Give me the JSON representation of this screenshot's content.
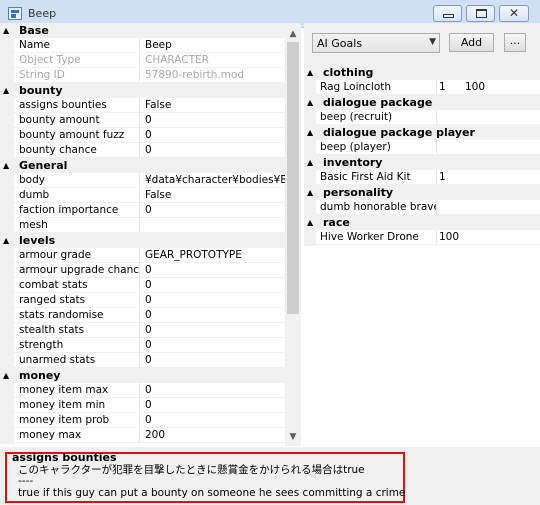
{
  "window": {
    "title": "Beep"
  },
  "left_grid": {
    "categories": [
      {
        "name": "Base",
        "rows": [
          {
            "name": "Name",
            "value": "Beep",
            "disabled": false
          },
          {
            "name": "Object Type",
            "value": "CHARACTER",
            "disabled": true
          },
          {
            "name": "String ID",
            "value": "57890-rebirth.mod",
            "disabled": true
          }
        ]
      },
      {
        "name": "bounty",
        "rows": [
          {
            "name": "assigns bounties",
            "value": "False",
            "disabled": false
          },
          {
            "name": "bounty amount",
            "value": "0",
            "disabled": false
          },
          {
            "name": "bounty amount fuzz",
            "value": "0",
            "disabled": false
          },
          {
            "name": "bounty chance",
            "value": "0",
            "disabled": false
          }
        ]
      },
      {
        "name": "General",
        "rows": [
          {
            "name": "body",
            "value": "¥data¥character¥bodies¥Be",
            "disabled": false
          },
          {
            "name": "dumb",
            "value": "False",
            "disabled": false
          },
          {
            "name": "faction importance",
            "value": "0",
            "disabled": false
          },
          {
            "name": "mesh",
            "value": "",
            "disabled": false
          }
        ]
      },
      {
        "name": "levels",
        "rows": [
          {
            "name": "armour grade",
            "value": "GEAR_PROTOTYPE",
            "disabled": false
          },
          {
            "name": "armour upgrade chance",
            "value": "0",
            "disabled": false
          },
          {
            "name": "combat stats",
            "value": "0",
            "disabled": false
          },
          {
            "name": "ranged stats",
            "value": "0",
            "disabled": false
          },
          {
            "name": "stats randomise",
            "value": "0",
            "disabled": false
          },
          {
            "name": "stealth stats",
            "value": "0",
            "disabled": false
          },
          {
            "name": "strength",
            "value": "0",
            "disabled": false
          },
          {
            "name": "unarmed stats",
            "value": "0",
            "disabled": false
          }
        ]
      },
      {
        "name": "money",
        "rows": [
          {
            "name": "money item max",
            "value": "0",
            "disabled": false
          },
          {
            "name": "money item min",
            "value": "0",
            "disabled": false
          },
          {
            "name": "money item prob",
            "value": "0",
            "disabled": false
          },
          {
            "name": "money max",
            "value": "200",
            "disabled": false
          }
        ]
      }
    ]
  },
  "right_panel": {
    "dropdown": {
      "selected": "AI Goals"
    },
    "add_label": "Add",
    "more_label": "...",
    "categories": [
      {
        "name": "clothing",
        "rows": [
          {
            "name": "Rag Loincloth",
            "value": "1",
            "value2": "100"
          }
        ]
      },
      {
        "name": "dialogue package",
        "rows": [
          {
            "name": "beep (recruit)",
            "value": "",
            "value2": ""
          }
        ]
      },
      {
        "name": "dialogue package player",
        "rows": [
          {
            "name": "beep (player)",
            "value": "",
            "value2": ""
          }
        ]
      },
      {
        "name": "inventory",
        "rows": [
          {
            "name": "Basic First Aid Kit",
            "value": "1",
            "value2": ""
          }
        ]
      },
      {
        "name": "personality",
        "rows": [
          {
            "name": "dumb honorable brave",
            "value": "",
            "value2": ""
          }
        ]
      },
      {
        "name": "race",
        "rows": [
          {
            "name": "Hive Worker Drone",
            "value": "100",
            "value2": ""
          }
        ]
      }
    ]
  },
  "description": {
    "title": "assigns bounties",
    "line_jp": "このキャラクターが犯罪を目撃したときに懸賞金をかけられる場合はtrue",
    "separator": "----",
    "line_en": "true if this guy can put a bounty on someone he sees committing a crime"
  },
  "icons": {
    "collapse": "▲",
    "scroll_up": "▲",
    "scroll_down": "▼",
    "dropdown_arrow": "▼"
  },
  "colors": {
    "highlight_border": "#e01010",
    "panel_bg": "#f0f0f0",
    "titlebar": "#cfe0f4"
  }
}
